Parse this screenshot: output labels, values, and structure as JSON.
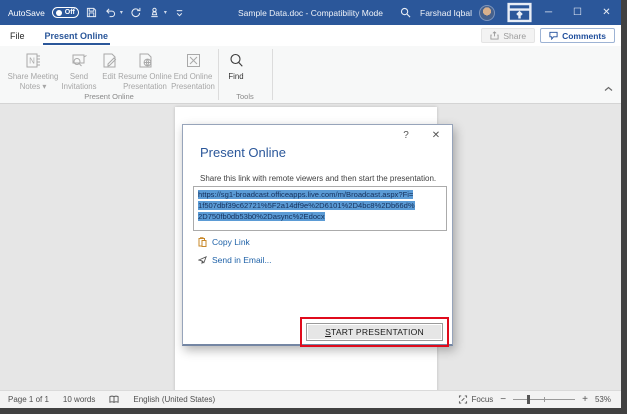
{
  "titlebar": {
    "autosave_label": "AutoSave",
    "autosave_state": "Off",
    "title": "Sample Data.doc - Compatibility Mode",
    "user_name": "Farshad Iqbal",
    "minimize": "─",
    "maximize": "☐",
    "close": "✕"
  },
  "tabs": {
    "file": "File",
    "present_online": "Present Online",
    "share": "Share",
    "comments": "Comments"
  },
  "ribbon": {
    "groups": [
      {
        "label": "Present Online",
        "buttons": [
          {
            "label": "Share Meeting Notes",
            "caret": "▾"
          },
          {
            "label": "Send Invitations"
          },
          {
            "label": "Edit"
          },
          {
            "label": "Resume Online Presentation"
          },
          {
            "label": "End Online Presentation"
          }
        ]
      },
      {
        "label": "Tools",
        "buttons": [
          {
            "label": "Find"
          }
        ]
      }
    ]
  },
  "dialog": {
    "help": "?",
    "close": "✕",
    "title": "Present Online",
    "instruction": "Share this link with remote viewers and then start the presentation.",
    "link_full": "https://sg1-broadcast.officeapps.live.com/m/Broadcast.aspx?Fi=1f507dbf39c62721%5F2a14df9e%2D6101%2D4bc8%2Db66d%2D750fb0db53b0%2Dasync%2Edocx",
    "link_lines": [
      "https://sg1-broadcast.officeapps.live.com/m/Broadcast.aspx?Fi=",
      "1f507dbf39c62721%5F2a14df9e%2D6101%2D4bc8%2Db66d%",
      "2D750fb0db53b0%2Dasync%2Edocx"
    ],
    "copy_link": "Copy Link",
    "send_email": "Send in Email...",
    "start_button_acc": "S",
    "start_button_rest": "TART PRESENTATION"
  },
  "statusbar": {
    "page": "Page 1 of 1",
    "words": "10 words",
    "language": "English (United States)",
    "focus": "Focus",
    "zoom_out": "−",
    "zoom_in": "+",
    "zoom_level": "53%"
  },
  "colors": {
    "titlebar_blue": "#2b579a",
    "selection_highlight": "#5b9bd5",
    "annotation_red": "#e00b1c"
  }
}
